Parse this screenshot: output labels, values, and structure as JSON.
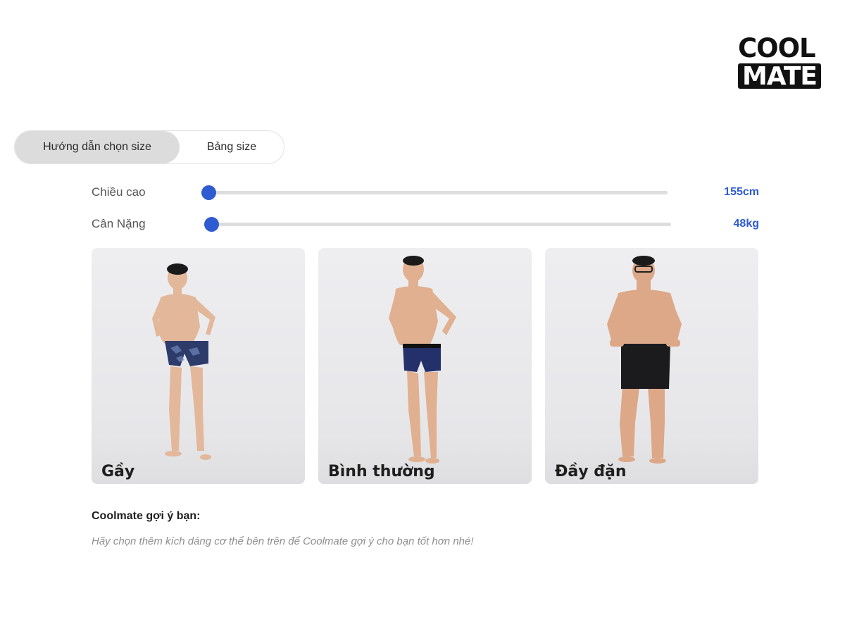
{
  "brand": {
    "logo_line1": "COOL",
    "logo_line2": "MATE"
  },
  "tabs": [
    {
      "label": "Hướng dẫn chọn size",
      "active": true
    },
    {
      "label": "Bảng size",
      "active": false
    }
  ],
  "sliders": {
    "height": {
      "label": "Chiều cao",
      "value_text": "155cm",
      "value": 155,
      "unit": "cm",
      "level": 0
    },
    "weight": {
      "label": "Cân Nặng",
      "value_text": "48kg",
      "value": 48,
      "unit": "kg",
      "level": 0
    }
  },
  "body_types": [
    {
      "label": "Gầy",
      "shorts_color": "#2d3b6b"
    },
    {
      "label": "Bình thường",
      "shorts_color": "#24306a"
    },
    {
      "label": "Đầy đặn",
      "shorts_color": "#1b1b1d"
    }
  ],
  "suggestion": {
    "title": "Coolmate gợi ý bạn:",
    "text": "Hãy chọn thêm kích dáng cơ thể bên trên để Coolmate gợi ý cho bạn tốt hơn nhé!"
  },
  "colors": {
    "accent": "#2f5bd0",
    "tab_active_bg": "#dcdcdc",
    "track": "#dddddd"
  }
}
